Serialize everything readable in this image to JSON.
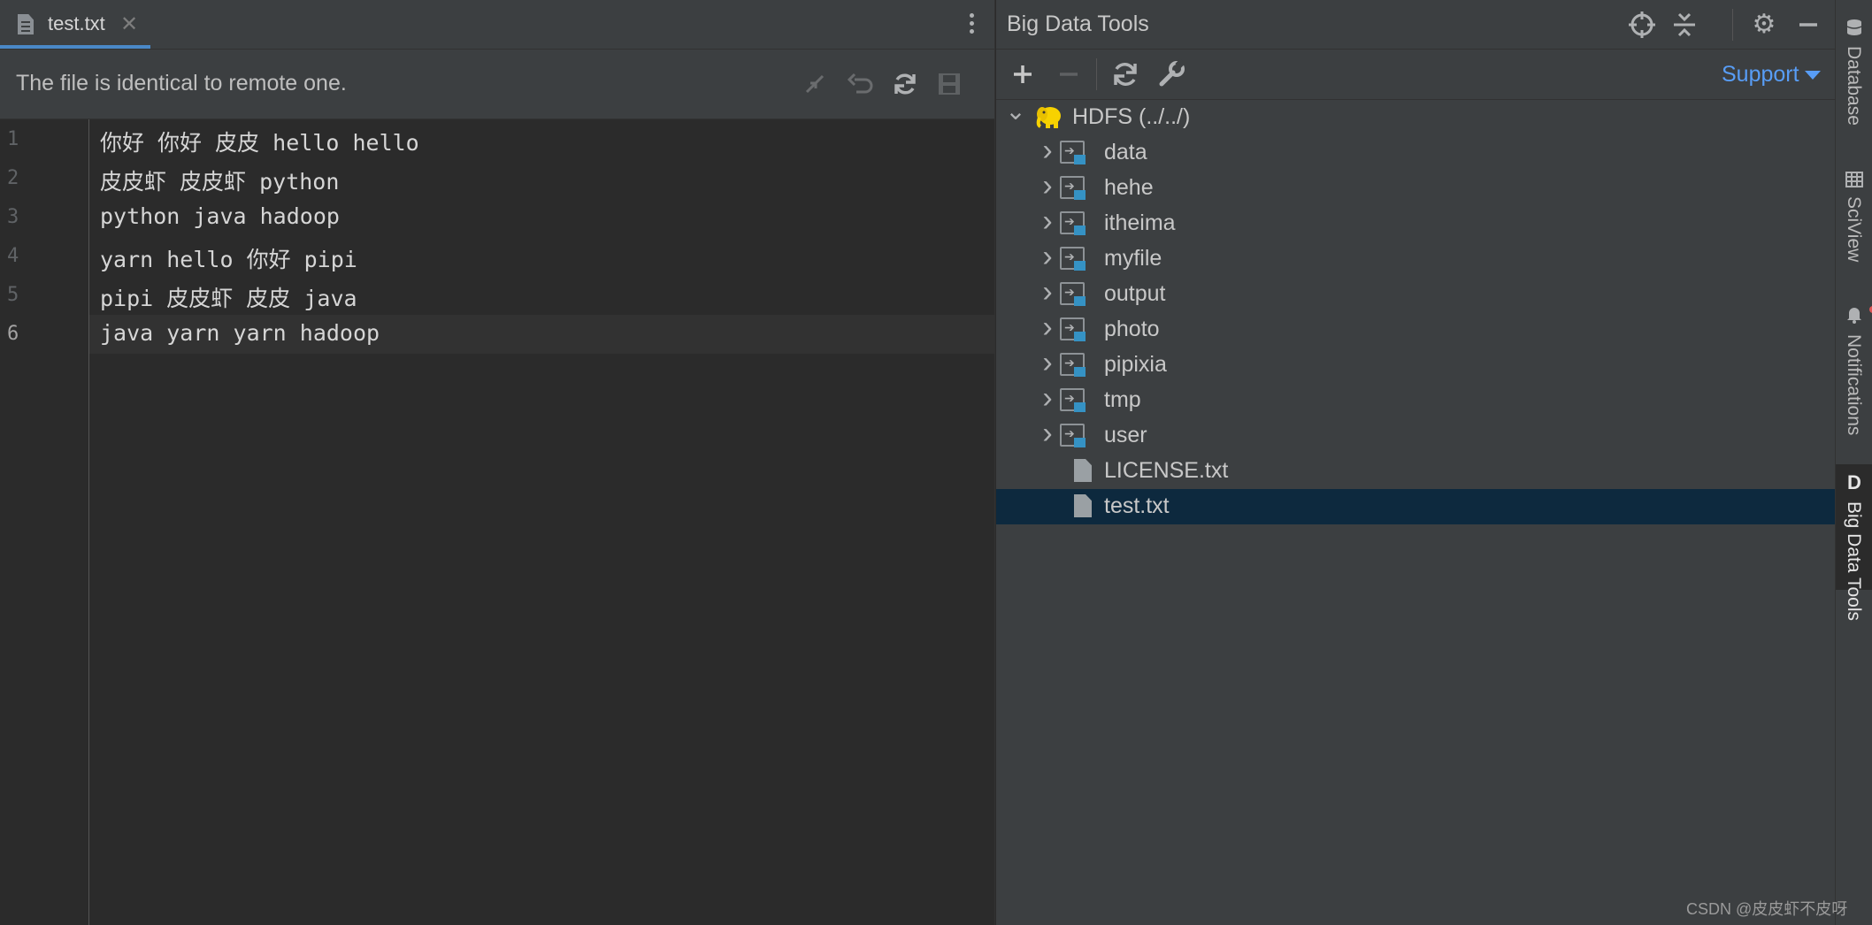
{
  "editor": {
    "tab": {
      "label": "test.txt",
      "close": "✕"
    },
    "notice": "The file is identical to remote one.",
    "lines": [
      {
        "no": "1",
        "text": "你好 你好 皮皮 hello hello"
      },
      {
        "no": "2",
        "text": "皮皮虾 皮皮虾 python"
      },
      {
        "no": "3",
        "text": "python java hadoop"
      },
      {
        "no": "4",
        "text": "yarn hello 你好 pipi"
      },
      {
        "no": "5",
        "text": "pipi 皮皮虾 皮皮 java"
      },
      {
        "no": "6",
        "text": "java yarn yarn hadoop"
      }
    ]
  },
  "bdt": {
    "title": "Big Data Tools",
    "support_label": "Support",
    "tree": {
      "root": "HDFS (../../)",
      "folders": [
        "data",
        "hehe",
        "itheima",
        "myfile",
        "output",
        "photo",
        "pipixia",
        "tmp",
        "user"
      ],
      "files": [
        "LICENSE.txt",
        "test.txt"
      ],
      "selected": "test.txt"
    }
  },
  "stripe": {
    "tabs": [
      "Database",
      "SciView",
      "Notifications",
      "Big Data Tools"
    ],
    "active": "Big Data Tools",
    "active_icon": "D"
  },
  "watermark": "CSDN @皮皮虾不皮呀",
  "colors": {
    "accent": "#4a88c7",
    "link": "#589df6",
    "selection": "#0d293e",
    "folder_badge": "#3592c4"
  },
  "icons": {
    "tab": "text-file-icon",
    "compare": "compare-icon",
    "revert": "revert-icon",
    "sync": "sync-icon",
    "save": "save-icon",
    "locate": "locate-icon",
    "collapse": "collapse-all-icon",
    "settings": "gear-icon",
    "minimize": "minimize-icon",
    "add": "plus-icon",
    "remove": "minus-icon",
    "refresh": "refresh-icon",
    "wrench": "wrench-icon",
    "hdfs": "hadoop-elephant-icon"
  }
}
